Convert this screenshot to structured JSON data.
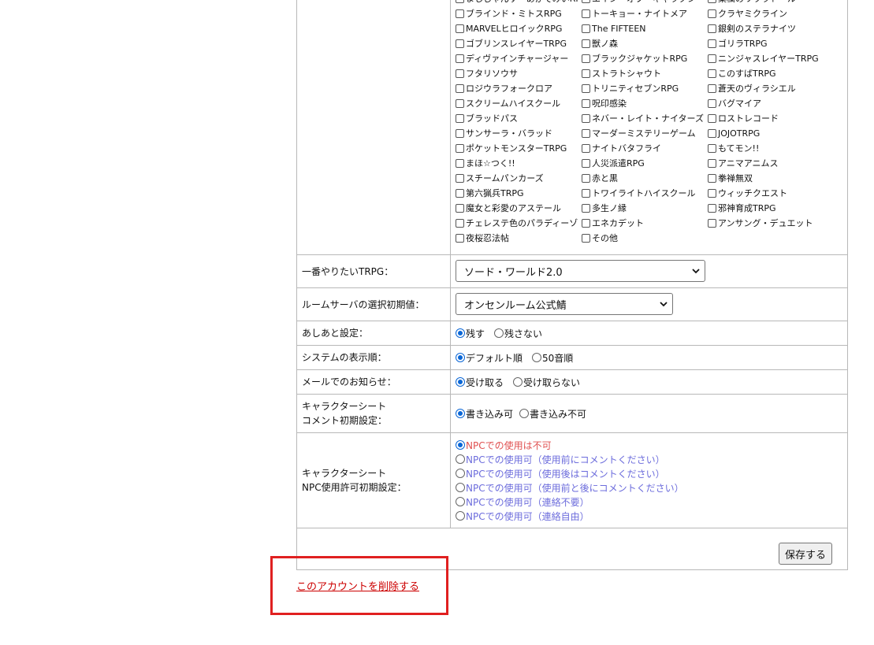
{
  "systems": {
    "columns": [
      [
        "ましじゃんす・あかでみいRPG",
        "ブラインド・ミトスRPG",
        "MARVELヒロイックRPG",
        "ゴブリンスレイヤーTRPG",
        "ディヴァインチャージャー",
        "フタリソウサ",
        "ロジウラフォークロア",
        "スクリームハイスクール",
        "ブラッドパス",
        "サンサーラ・バラッド",
        "ポケットモンスターTRPG",
        "まほ☆つく!!",
        "スチームパンカーズ",
        "第六猟兵TRPG",
        "魔女と彩愛のアステール",
        "チェレステ色のパラディーゾ",
        "夜桜忍法帖"
      ],
      [
        "エイン・オブ・ギャラクシー",
        "トーキョー・ナイトメア",
        "The FIFTEEN",
        "獣ノ森",
        "ブラックジャケットRPG",
        "ストラトシャウト",
        "トリニティセブンRPG",
        "呪印感染",
        "ネバー・レイト・ナイターズ",
        "マーダーミステリーゲーム",
        "ナイトバタフライ",
        "人災派遣RPG",
        "赤と黒",
        "トワイライトハイスクール",
        "多生ノ縁",
        "エネカデット",
        "その他"
      ],
      [
        "薬欄のリワラドール",
        "クラヤミクライン",
        "銀剣のステラナイツ",
        "ゴリラTRPG",
        "ニンジャスレイヤーTRPG",
        "このすばTRPG",
        "蒼天のヴィラシエル",
        "バグマイア",
        "ロストレコード",
        "JOJOTRPG",
        "もてモン!!",
        "アニマアニムス",
        "拳禅無双",
        "ウィッチクエスト",
        "邪神育成TRPG",
        "アンサング・デュエット"
      ]
    ]
  },
  "fav_trpg": {
    "label": "一番やりたいTRPG：",
    "value": "ソード・ワールド2.0"
  },
  "room_server": {
    "label": "ルームサーバの選択初期値：",
    "value": "オンセンルーム公式鯖"
  },
  "footprint": {
    "label": "あしあと設定：",
    "options": [
      "残す",
      "残さない"
    ]
  },
  "system_order": {
    "label": "システムの表示順：",
    "options": [
      "デフォルト順",
      "50音順"
    ]
  },
  "mail_notice": {
    "label": "メールでのお知らせ：",
    "options": [
      "受け取る",
      "受け取らない"
    ]
  },
  "sheet_comment": {
    "label_line1": "キャラクターシート",
    "label_line2": "コメント初期設定：",
    "options": [
      "書き込み可",
      "書き込み不可"
    ]
  },
  "npc_permission": {
    "label_line1": "キャラクターシート",
    "label_line2": "NPC使用許可初期設定：",
    "options": [
      "NPCでの使用は不可",
      "NPCでの使用可（使用前にコメントください）",
      "NPCでの使用可（使用後はコメントください）",
      "NPCでの使用可（使用前と後にコメントください）",
      "NPCでの使用可（連絡不要）",
      "NPCでの使用可（連絡自由）"
    ],
    "colors": {
      "disabled": "#e05050",
      "allowed": "#6c6cdc"
    }
  },
  "save_button": "保存する",
  "delete_link": "このアカウントを削除する",
  "accent_colors": {
    "highlight_box": "#e02020",
    "link": "#cc0000",
    "radio": "#0a66d6"
  }
}
